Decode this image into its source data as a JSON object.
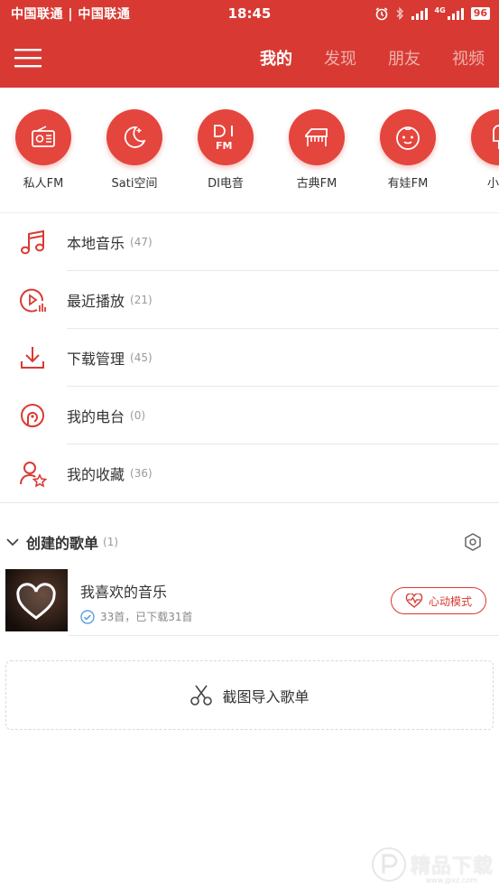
{
  "status_bar": {
    "carrier": "中国联通 | 中国联通",
    "time": "18:45",
    "network": "4G",
    "battery": "96"
  },
  "nav": {
    "tabs": [
      "我的",
      "发现",
      "朋友",
      "视频"
    ],
    "active_tab": "我的"
  },
  "quick_access": [
    {
      "label": "私人FM",
      "icon": "radio-icon"
    },
    {
      "label": "Sati空间",
      "icon": "moon-icon"
    },
    {
      "label": "DI电音",
      "icon": "di-fm-icon"
    },
    {
      "label": "古典FM",
      "icon": "piano-icon"
    },
    {
      "label": "有娃FM",
      "icon": "baby-face-icon"
    },
    {
      "label": "小冰",
      "icon": "popsicle-icon"
    }
  ],
  "menu": [
    {
      "label": "本地音乐",
      "count": "(47)",
      "icon": "music-note-icon"
    },
    {
      "label": "最近播放",
      "count": "(21)",
      "icon": "recent-play-icon"
    },
    {
      "label": "下载管理",
      "count": "(45)",
      "icon": "download-icon"
    },
    {
      "label": "我的电台",
      "count": "(0)",
      "icon": "radio-station-icon"
    },
    {
      "label": "我的收藏",
      "count": "(36)",
      "icon": "favorite-user-icon"
    }
  ],
  "created_playlists": {
    "title": "创建的歌单",
    "count": "(1)",
    "items": [
      {
        "name": "我喜欢的音乐",
        "meta": "33首，已下载31首",
        "action": "心动模式"
      }
    ]
  },
  "import": {
    "label": "截图导入歌单"
  },
  "watermark": {
    "text": "精品下载",
    "sub": "www.jpxz.com"
  },
  "colors": {
    "brand": "#d83a33",
    "text": "#333333",
    "muted": "#999999"
  }
}
